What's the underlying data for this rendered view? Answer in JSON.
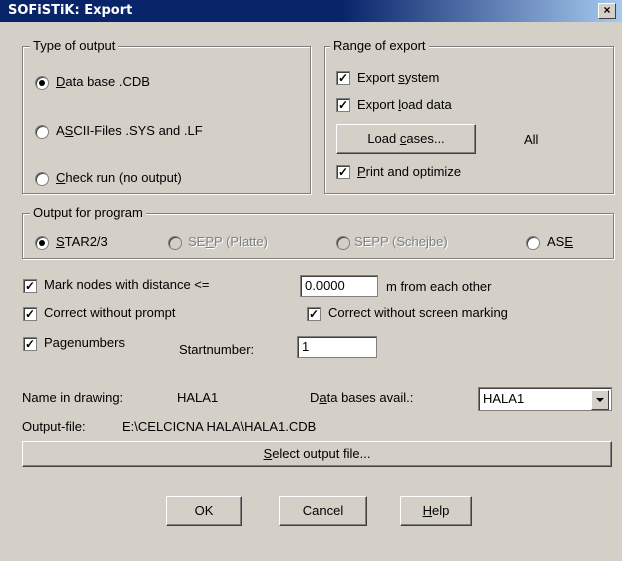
{
  "window": {
    "title": "SOFiSTiK: Export",
    "close_glyph": "×"
  },
  "type_of_output": {
    "legend": "Type of output",
    "options": [
      {
        "pre": "",
        "u": "D",
        "post": "ata base .CDB",
        "selected": true
      },
      {
        "pre": "A",
        "u": "S",
        "post": "CII-Files .SYS and .LF",
        "selected": false
      },
      {
        "pre": "",
        "u": "C",
        "post": "heck run (no output)",
        "selected": false
      }
    ]
  },
  "range_of_export": {
    "legend": "Range of export",
    "export_system": {
      "pre": "Export ",
      "u": "s",
      "post": "ystem",
      "checked": true
    },
    "export_load": {
      "pre": "Export ",
      "u": "l",
      "post": "oad data",
      "checked": true
    },
    "load_cases_button": {
      "pre": "Load ",
      "u": "c",
      "post": "ases..."
    },
    "load_cases_value": "All",
    "print_optimize": {
      "pre": "",
      "u": "P",
      "post": "rint and optimize",
      "checked": true
    }
  },
  "output_for_program": {
    "legend": "Output for program",
    "options": [
      {
        "pre": "",
        "u": "S",
        "post": "TAR2/3",
        "selected": true,
        "enabled": true
      },
      {
        "pre": "SE",
        "u": "P",
        "post": "P (Platte)",
        "selected": false,
        "enabled": false
      },
      {
        "pre": "SEPP (Sche",
        "u": "j",
        "post": "be)",
        "selected": false,
        "enabled": false
      },
      {
        "pre": "AS",
        "u": "E",
        "post": "",
        "selected": false,
        "enabled": true
      }
    ]
  },
  "options": {
    "mark_nodes": {
      "label": "Mark nodes with distance <=",
      "checked": true
    },
    "distance_value": "0.0000",
    "distance_suffix": "m from each other",
    "correct_without_prompt": {
      "label": "Correct without prompt",
      "checked": true
    },
    "correct_without_marking": {
      "label": "Correct without screen marking",
      "checked": true
    },
    "pagenumbers": {
      "label": "Pagenumbers",
      "checked": true
    },
    "startnumber_label": "Startnumber:",
    "startnumber_value": "1"
  },
  "drawing": {
    "name_label": "Name in drawing:",
    "name_value": "HALA1",
    "db_label_pre": "D",
    "db_label_u": "a",
    "db_label_post": "ta bases avail.:",
    "db_selected": "HALA1"
  },
  "output_file": {
    "label": "Output-file:",
    "path": "E:\\CELCICNA HALA\\HALA1.CDB",
    "select_button": {
      "pre": "",
      "u": "S",
      "post": "elect output file..."
    }
  },
  "buttons": {
    "ok": "OK",
    "cancel": "Cancel",
    "help": {
      "pre": "",
      "u": "H",
      "post": "elp"
    }
  }
}
